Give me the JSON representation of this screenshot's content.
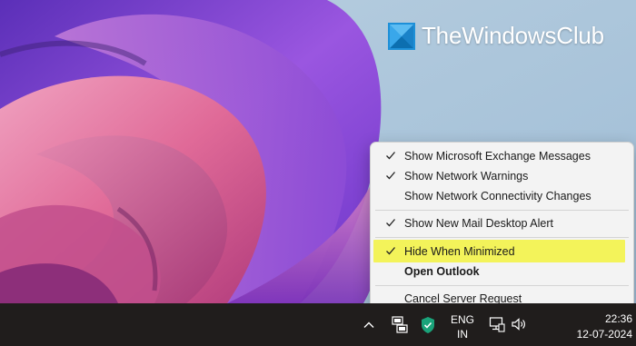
{
  "watermark": {
    "text": "TheWindowsClub"
  },
  "menu": {
    "items": [
      {
        "label": "Show Microsoft Exchange Messages",
        "checked": true,
        "bold": false,
        "highlighted": false
      },
      {
        "label": "Show Network Warnings",
        "checked": true,
        "bold": false,
        "highlighted": false
      },
      {
        "label": "Show Network Connectivity Changes",
        "checked": false,
        "bold": false,
        "highlighted": false
      },
      {
        "label": "Show New Mail Desktop Alert",
        "checked": true,
        "bold": false,
        "highlighted": false
      },
      {
        "label": "Hide When Minimized",
        "checked": true,
        "bold": false,
        "highlighted": true
      },
      {
        "label": "Open Outlook",
        "checked": false,
        "bold": true,
        "highlighted": false
      },
      {
        "label": "Cancel Server Request",
        "checked": false,
        "bold": false,
        "highlighted": false
      }
    ]
  },
  "taskbar": {
    "tray_icons": [
      "chevron-up-icon",
      "outlook-tray-icon",
      "security-shield-icon",
      "network-icon",
      "volume-icon"
    ],
    "language": {
      "line1": "ENG",
      "line2": "IN"
    },
    "clock": {
      "time": "22:36",
      "date": "12-07-2024"
    }
  },
  "colors": {
    "highlight": "#f3f35a",
    "taskbar": "#201d1c",
    "shield": "#1aa37a",
    "menu_bg": "#f3f3f3"
  }
}
